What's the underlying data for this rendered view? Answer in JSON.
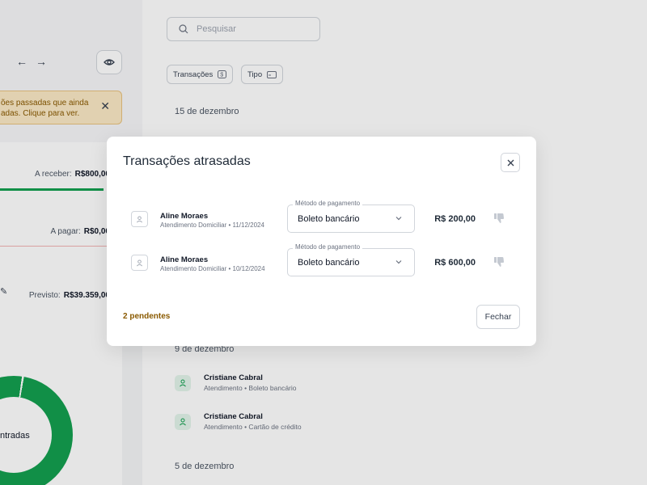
{
  "sidebar": {
    "alert": {
      "line1": "ões passadas que ainda",
      "line2": "adas. Clique para ver."
    },
    "summary": {
      "receive_label": "A receber:",
      "receive_value": "R$800,00",
      "pay_label": "A pagar:",
      "pay_value": "R$0,00",
      "forecast_label": "Previsto:",
      "forecast_value": "R$39.359,00"
    },
    "donut_label": "ntradas",
    "colors": {
      "income": "#14a050"
    }
  },
  "main": {
    "search": {
      "placeholder": "Pesquisar"
    },
    "filters": [
      {
        "label": "Transações"
      },
      {
        "label": "Tipo"
      }
    ],
    "dates": [
      "15 de dezembro",
      "9 de dezembro",
      "5 de dezembro"
    ],
    "transactions": [
      {
        "name": "Cristiane Cabral",
        "subtitle": "Atendimento • Boleto bancário"
      },
      {
        "name": "Cristiane Cabral",
        "subtitle": "Atendimento • Cartão de crédito"
      }
    ]
  },
  "modal": {
    "title": "Transações atrasadas",
    "rows": [
      {
        "name": "Aline Moraes",
        "subtitle": "Atendimento Domiciliar • 11/12/2024",
        "method_label": "Método de pagamento",
        "method_value": "Boleto bancário",
        "amount": "R$ 200,00"
      },
      {
        "name": "Aline Moraes",
        "subtitle": "Atendimento Domiciliar • 10/12/2024",
        "method_label": "Método de pagamento",
        "method_value": "Boleto bancário",
        "amount": "R$ 600,00"
      }
    ],
    "pending": "2 pendentes",
    "close_label": "Fechar",
    "colors": {
      "pending": "#8a5a00"
    }
  }
}
